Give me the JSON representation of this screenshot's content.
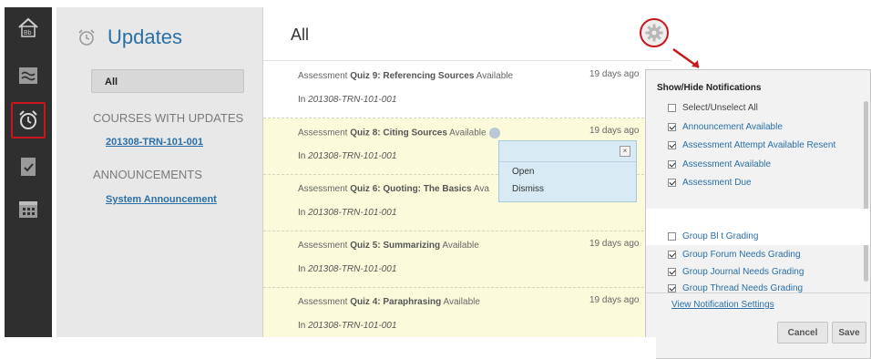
{
  "rail": {
    "items": [
      {
        "icon": "home-bb-icon"
      },
      {
        "icon": "stream-icon"
      },
      {
        "icon": "alarm-clock-icon",
        "active": true
      },
      {
        "icon": "checklist-icon"
      },
      {
        "icon": "calendar-icon"
      }
    ],
    "active_border_color": "#c8161d"
  },
  "sidebar": {
    "title": "Updates",
    "filter_all": "All",
    "courses_heading": "COURSES WITH UPDATES",
    "course_link": "201308-TRN-101-001",
    "announcements_heading": "ANNOUNCEMENTS",
    "announcement_link": "System Announcement"
  },
  "main": {
    "title": "All",
    "notifications": [
      {
        "prefix": "Assessment ",
        "name": "Quiz 9: Referencing Sources",
        "suffix": " Available",
        "course": "201308-TRN-101-001",
        "time": "19 days ago",
        "highlight": false
      },
      {
        "prefix": "Assessment ",
        "name": "Quiz 8: Citing Sources",
        "suffix": " Available",
        "course": "201308-TRN-101-001",
        "time": "19 days ago",
        "highlight": true
      },
      {
        "prefix": "Assessment ",
        "name": "Quiz 6: Quoting: The Basics",
        "suffix": " Ava",
        "course": "201308-TRN-101-001",
        "time": "",
        "highlight": true
      },
      {
        "prefix": "Assessment ",
        "name": "Quiz 5: Summarizing",
        "suffix": " Available",
        "course": "201308-TRN-101-001",
        "time": "19 days ago",
        "highlight": true
      },
      {
        "prefix": "Assessment ",
        "name": "Quiz 4: Paraphrasing",
        "suffix": " Available",
        "course": "201308-TRN-101-001",
        "time": "19 days ago",
        "highlight": true
      }
    ],
    "course_prefix": "In ",
    "popup": {
      "close": "×",
      "open": "Open",
      "dismiss": "Dismiss"
    }
  },
  "show_hide": {
    "title": "Show/Hide Notifications",
    "select_all": "Select/Unselect All",
    "items": [
      {
        "label": "Announcement Available",
        "checked": true
      },
      {
        "label": "Assessment Attempt Available Resent",
        "checked": true
      },
      {
        "label": "Assessment Available",
        "checked": true
      },
      {
        "label": "Assessment Due",
        "checked": true
      },
      {
        "label": "Group Bl      t  Grading",
        "checked": false
      },
      {
        "label": "Group Forum Needs Grading",
        "checked": true
      },
      {
        "label": "Group Journal Needs Grading",
        "checked": true
      },
      {
        "label": "Group Thread Needs Grading",
        "checked": true
      }
    ],
    "view_settings": "View Notification Settings",
    "cancel": "Cancel",
    "save": "Save"
  },
  "colors": {
    "accent_blue": "#2a6fa8",
    "highlight_yellow": "#fbfbdc",
    "annotation_red": "#c8161d"
  }
}
